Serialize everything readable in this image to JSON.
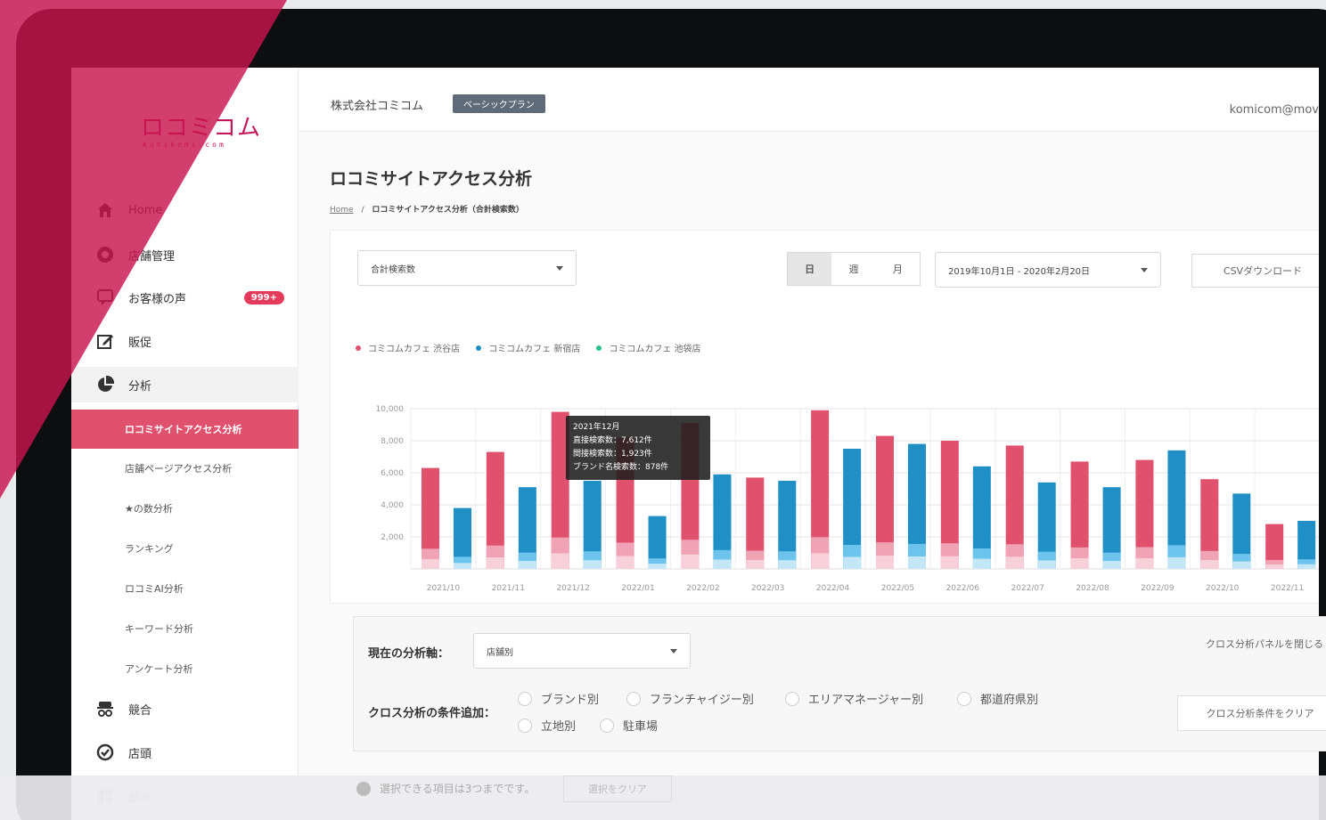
{
  "brand": {
    "logo": "ロコミコム",
    "logo_sub": "kutikomi.com",
    "accent": "#e0516e"
  },
  "header": {
    "company": "株式会社コミコム",
    "plan": "ベーシックプラン",
    "user": "komicom@mov"
  },
  "sidebar": {
    "items": [
      {
        "label": "Home",
        "icon": "home-icon"
      },
      {
        "label": "店舗管理",
        "icon": "store-circle-icon"
      },
      {
        "label": "お客様の声",
        "icon": "chat-icon",
        "badge": "999+"
      },
      {
        "label": "販促",
        "icon": "edit-icon"
      },
      {
        "label": "分析",
        "icon": "pie-chart-icon"
      }
    ],
    "sub_items": [
      "ロコミサイトアクセス分析",
      "店舗ページアクセス分析",
      "★の数分析",
      "ランキング",
      "ロコミAI分析",
      "キーワード分析",
      "アンケート分析"
    ],
    "bottom_items": [
      {
        "label": "競合",
        "icon": "spy-icon"
      },
      {
        "label": "店頭",
        "icon": "check-badge-icon"
      },
      {
        "label": "基本",
        "icon": "grid-icon"
      }
    ]
  },
  "page": {
    "title": "ロコミサイトアクセス分析",
    "breadcrumb_home": "Home",
    "breadcrumb_sep": "/",
    "breadcrumb_current": "ロコミサイトアクセス分析（合計検索数）"
  },
  "controls": {
    "metric_select": "合計検索数",
    "period_tabs": [
      "日",
      "週",
      "月"
    ],
    "date_range": "2019年10月1日 - 2020年2月20日",
    "csv_button": "CSVダウンロード"
  },
  "legend": [
    {
      "name": "コミコムカフェ 渋谷店",
      "color": "#e0516e"
    },
    {
      "name": "コミコムカフェ 新宿店",
      "color": "#1f8fc6"
    },
    {
      "name": "コミコムカフェ 池袋店",
      "color": "#2bbf8f"
    }
  ],
  "chart_data": {
    "type": "bar",
    "y_ticks": [
      "10,000",
      "8,000",
      "6,000",
      "4,000",
      "2,000"
    ],
    "ylim": [
      0,
      10000
    ],
    "categories": [
      "2021/10",
      "2021/11",
      "2021/12",
      "2022/01",
      "2022/02",
      "2022/03",
      "2022/04",
      "2022/05",
      "2022/06",
      "2022/07",
      "2022/08",
      "2022/09",
      "2022/10",
      "2022/11"
    ],
    "series": [
      {
        "values": [
          6300,
          7300,
          9800,
          8200,
          9100,
          5700,
          9900,
          8300,
          8000,
          7700,
          6700,
          6800,
          5600,
          2800
        ],
        "color": "#e0516e"
      },
      {
        "values": [
          3800,
          5100,
          5500,
          3300,
          5900,
          5500,
          7500,
          7800,
          6400,
          5400,
          5100,
          7400,
          4700,
          3000
        ],
        "color": "#1f8fc6"
      }
    ],
    "tooltip": {
      "title": "2021年12月",
      "lines": [
        "直接検索数：7,612件",
        "間接検索数：1,923件",
        "ブランド名検索数：878件"
      ]
    }
  },
  "cross": {
    "axis_label": "現在の分析軸：",
    "axis_value": "店舗別",
    "close_label": "クロス分析パネルを閉じる",
    "add_label": "クロス分析の条件追加：",
    "options": [
      "ブランド別",
      "フランチャイジー別",
      "エリアマネージャー別",
      "都道府県別",
      "立地別",
      "駐車場"
    ],
    "clear_button": "クロス分析条件をクリア"
  },
  "footer": {
    "info": "選択できる項目は3つまでです。",
    "button": "選択をクリア"
  }
}
